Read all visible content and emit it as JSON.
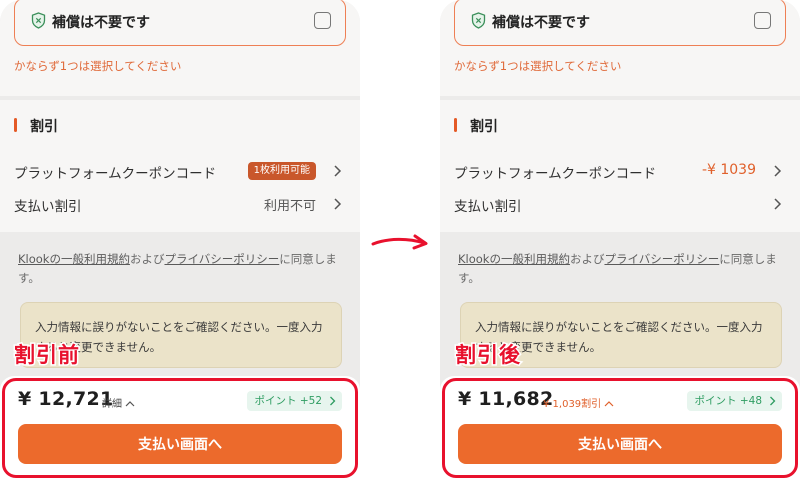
{
  "colors": {
    "accent": "#ec6a2c",
    "highlight_red": "#e8112d",
    "points_green": "#2f9d62"
  },
  "before": {
    "insurance": {
      "label": "補償は不要です",
      "icon": "shield-x-icon",
      "warning": "かならず1つは選択してください"
    },
    "discount": {
      "title": "割引",
      "coupon_label": "プラットフォームクーポンコード",
      "coupon_badge": "1枚利用可能",
      "payment_label": "支払い割引",
      "payment_value": "利用不可"
    },
    "terms": {
      "link1": "Klookの一般利用規約",
      "mid": "および",
      "link2": "プライバシーポリシー",
      "end": "に同意します。"
    },
    "notice": "入力情報に誤りがないことをご確認ください。一度入力すると変更できません。",
    "bottom": {
      "price": "¥ 12,721",
      "detail": "詳細",
      "points": "ポイント +52",
      "pay_button": "支払い画面へ"
    },
    "overlay_label": "割引前"
  },
  "after": {
    "insurance": {
      "label": "補償は不要です",
      "icon": "shield-x-icon",
      "warning": "かならず1つは選択してください"
    },
    "discount": {
      "title": "割引",
      "coupon_label": "プラットフォームクーポンコード",
      "coupon_value": "-¥ 1039",
      "payment_label": "支払い割引"
    },
    "terms": {
      "link1": "Klookの一般利用規約",
      "mid": "および",
      "link2": "プライバシーポリシー",
      "end": "に同意します。"
    },
    "notice": "入力情報に誤りがないことをご確認ください。一度入力すると変更できません。",
    "bottom": {
      "price": "¥ 11,682",
      "discount": "¥ 1,039割引",
      "points": "ポイント +48",
      "pay_button": "支払い画面へ"
    },
    "overlay_label": "割引後"
  }
}
